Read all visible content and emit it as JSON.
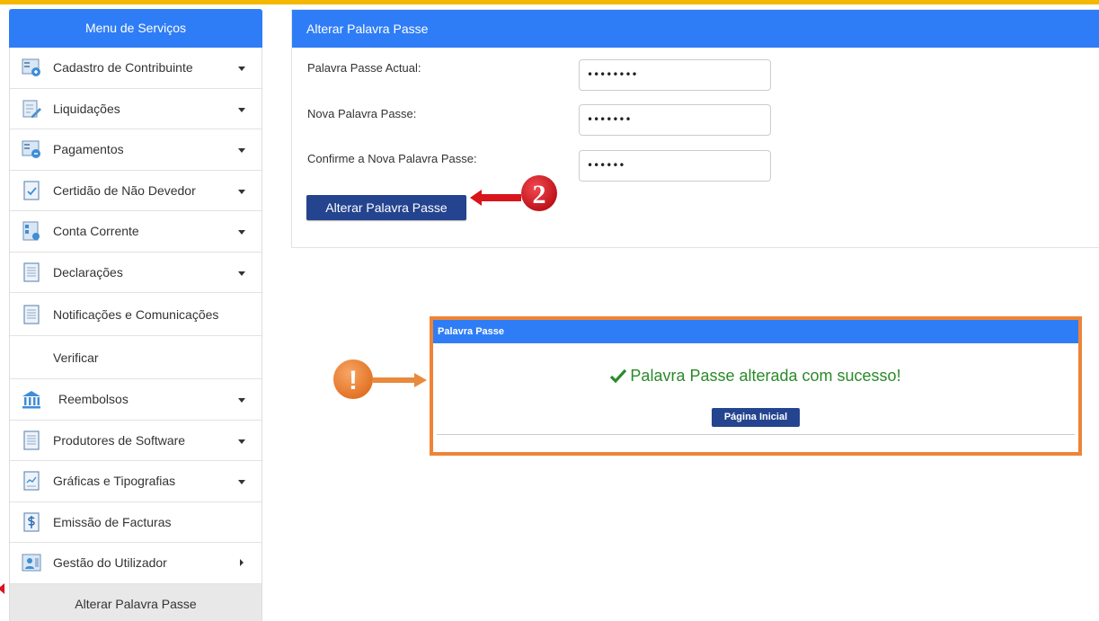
{
  "sidebar": {
    "title": "Menu de Serviços",
    "items": [
      {
        "label": "Cadastro de Contribuinte",
        "icon": "form-icon"
      },
      {
        "label": "Liquidações",
        "icon": "edit-form-icon"
      },
      {
        "label": "Pagamentos",
        "icon": "form-icon"
      },
      {
        "label": "Certidão de Não Devedor",
        "icon": "certificate-icon"
      },
      {
        "label": "Conta Corrente",
        "icon": "account-icon"
      },
      {
        "label": "Declarações",
        "icon": "document-icon"
      },
      {
        "label": "Notificações e Comunicações",
        "icon": "document-icon"
      },
      {
        "label": "Verificar"
      },
      {
        "label": "Reembolsos",
        "icon": "bank-icon"
      },
      {
        "label": "Produtores de Software",
        "icon": "document-icon"
      },
      {
        "label": "Gráficas e Tipografias",
        "icon": "print-icon"
      },
      {
        "label": "Emissão de Facturas",
        "icon": "invoice-icon"
      },
      {
        "label": "Gestão do Utilizador",
        "icon": "user-management-icon"
      }
    ],
    "subitem": "Alterar Palavra Passe"
  },
  "form": {
    "title": "Alterar Palavra Passe",
    "current_label": "Palavra Passe Actual:",
    "current_value": "••••••••",
    "new_label": "Nova Palavra Passe:",
    "new_value": "•••••••",
    "confirm_label": "Confirme a Nova Palavra Passe:",
    "confirm_value": "••••••",
    "submit_label": "Alterar Palavra Passe"
  },
  "callouts": {
    "step": "2",
    "alert": "!"
  },
  "dialog": {
    "title": "Palavra Passe",
    "message": "Palavra Passe alterada com sucesso!",
    "button_label": "Página Inicial"
  },
  "colors": {
    "brand_blue": "#2f7df6",
    "button_navy": "#24448f",
    "accent_yellow": "#f5b800",
    "callout_orange": "#ef8436",
    "callout_red": "#d8141c",
    "success_green": "#2a8a2a"
  }
}
